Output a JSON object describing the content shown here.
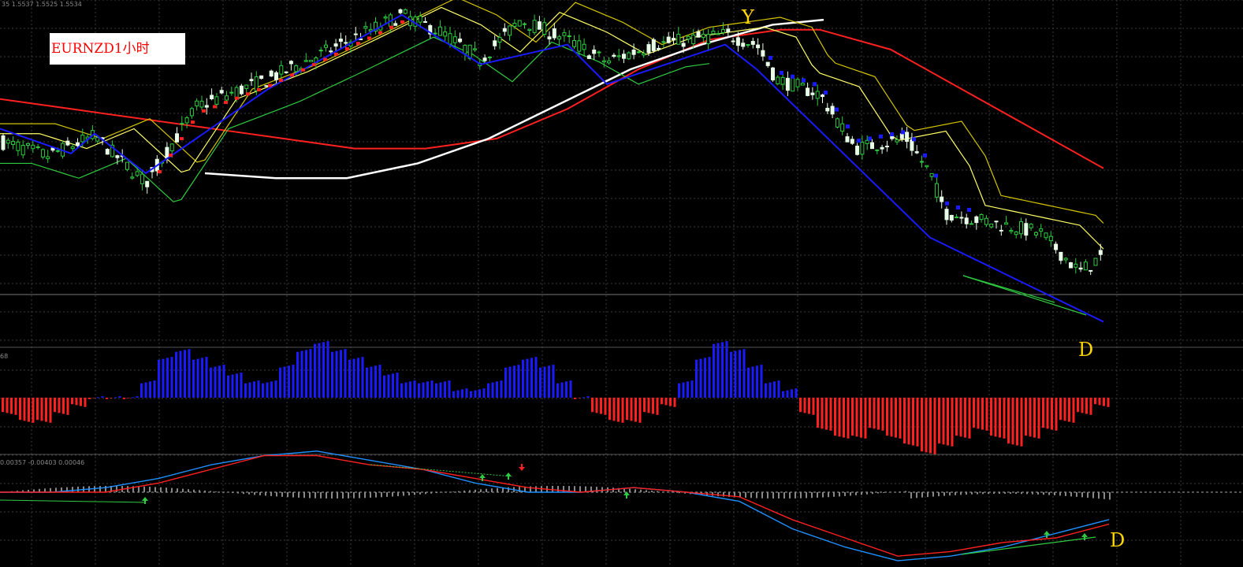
{
  "title_box": {
    "text": "EURNZD1小时"
  },
  "top_readout": "35 1.5537 1.5525 1.5534",
  "macd_readout": "0.00357 -0.00403 0.00046",
  "hist_readout": "68",
  "markers": {
    "top": "Y",
    "bottom": "D",
    "osc": "D"
  },
  "colors": {
    "bg": "#000000",
    "grid": "#3a3a3a",
    "bull": "#e8ffe8",
    "bear": "#2ecc40",
    "blue": "#1a1aff",
    "red": "#ff2020",
    "white": "#ffffff",
    "yellow": "#d4c400",
    "marker": "#ffd700",
    "title_text": "#ff0000"
  },
  "chart_data": [
    {
      "type": "candlestick",
      "title": "EURNZD1小时",
      "ylim": [
        1.55,
        1.62
      ],
      "ma_long_red": [
        1.6,
        1.598,
        1.596,
        1.594,
        1.592,
        1.59,
        1.59,
        1.592,
        1.598,
        1.606,
        1.612,
        1.614,
        1.614,
        1.61,
        1.602,
        1.594,
        1.586
      ],
      "ma_white": [
        1.585,
        1.584,
        1.584,
        1.587,
        1.592,
        1.599,
        1.606,
        1.611,
        1.615,
        1.616
      ],
      "zigzag_blue": [
        1.594,
        1.589,
        1.593,
        1.585,
        1.602,
        1.617,
        1.607,
        1.611,
        1.603,
        1.611,
        1.606,
        1.572,
        1.555
      ]
    },
    {
      "type": "bar",
      "title": "",
      "note": "histogram oscillator (blue positive / red negative)",
      "values": [
        -2,
        -3,
        -3,
        -2,
        -1,
        0,
        0,
        0,
        2,
        5,
        6,
        5,
        4,
        3,
        2,
        2,
        4,
        6,
        7,
        6,
        5,
        4,
        3,
        2,
        2,
        2,
        1,
        1,
        2,
        4,
        5,
        4,
        2,
        0,
        -2,
        -3,
        -3,
        -2,
        -1,
        2,
        5,
        7,
        6,
        4,
        2,
        1,
        -2,
        -4,
        -5,
        -5,
        -4,
        -5,
        -6,
        -7,
        -6,
        -5,
        -4,
        -5,
        -6,
        -5,
        -4,
        -3,
        -2,
        -1
      ]
    },
    {
      "type": "line",
      "title": "",
      "note": "MACD-style oscillator with zero line",
      "series": [
        {
          "values": [
            0,
            0,
            0.1,
            0.3,
            0.6,
            0.8,
            0.9,
            0.7,
            0.5,
            0.2,
            0,
            0,
            0.1,
            0,
            -0.2,
            -0.8,
            -1.2,
            -1.5,
            -1.4,
            -1.2,
            -0.9,
            -0.6
          ]
        },
        {
          "values": [
            0,
            0,
            0,
            0.2,
            0.5,
            0.8,
            0.8,
            0.6,
            0.5,
            0.3,
            0.1,
            0,
            0.1,
            0,
            -0.1,
            -0.6,
            -1.0,
            -1.4,
            -1.3,
            -1.1,
            -1.0,
            -0.7
          ]
        }
      ]
    }
  ]
}
